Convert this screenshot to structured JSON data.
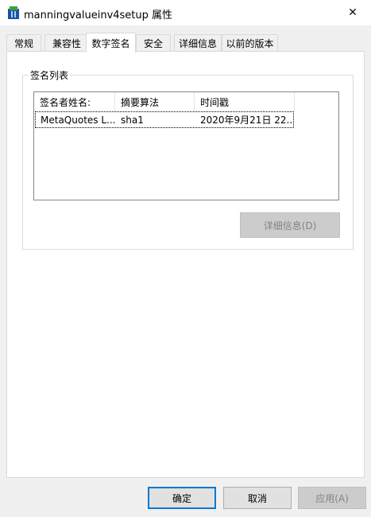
{
  "window": {
    "title": "manningvalueinv4setup 属性",
    "close_glyph": "✕"
  },
  "tabs": [
    {
      "label": "常规"
    },
    {
      "label": "兼容性"
    },
    {
      "label": "数字签名",
      "active": true
    },
    {
      "label": "安全"
    },
    {
      "label": "详细信息"
    },
    {
      "label": "以前的版本"
    }
  ],
  "signature_list": {
    "group_label": "签名列表",
    "columns": [
      "签名者姓名:",
      "摘要算法",
      "时间戳"
    ],
    "rows": [
      {
        "signer": "MetaQuotes L...",
        "digest": "sha1",
        "timestamp": "2020年9月21日 22..."
      }
    ]
  },
  "details_button": {
    "label": "详细信息(D)",
    "enabled": false
  },
  "footer": {
    "ok_label": "确定",
    "cancel_label": "取消",
    "apply_label": "应用(A)"
  },
  "colors": {
    "focus_border": "#0078d7",
    "disabled_text": "#838383",
    "icon_blue": "#1e4fa8",
    "icon_green": "#3aa03a"
  }
}
